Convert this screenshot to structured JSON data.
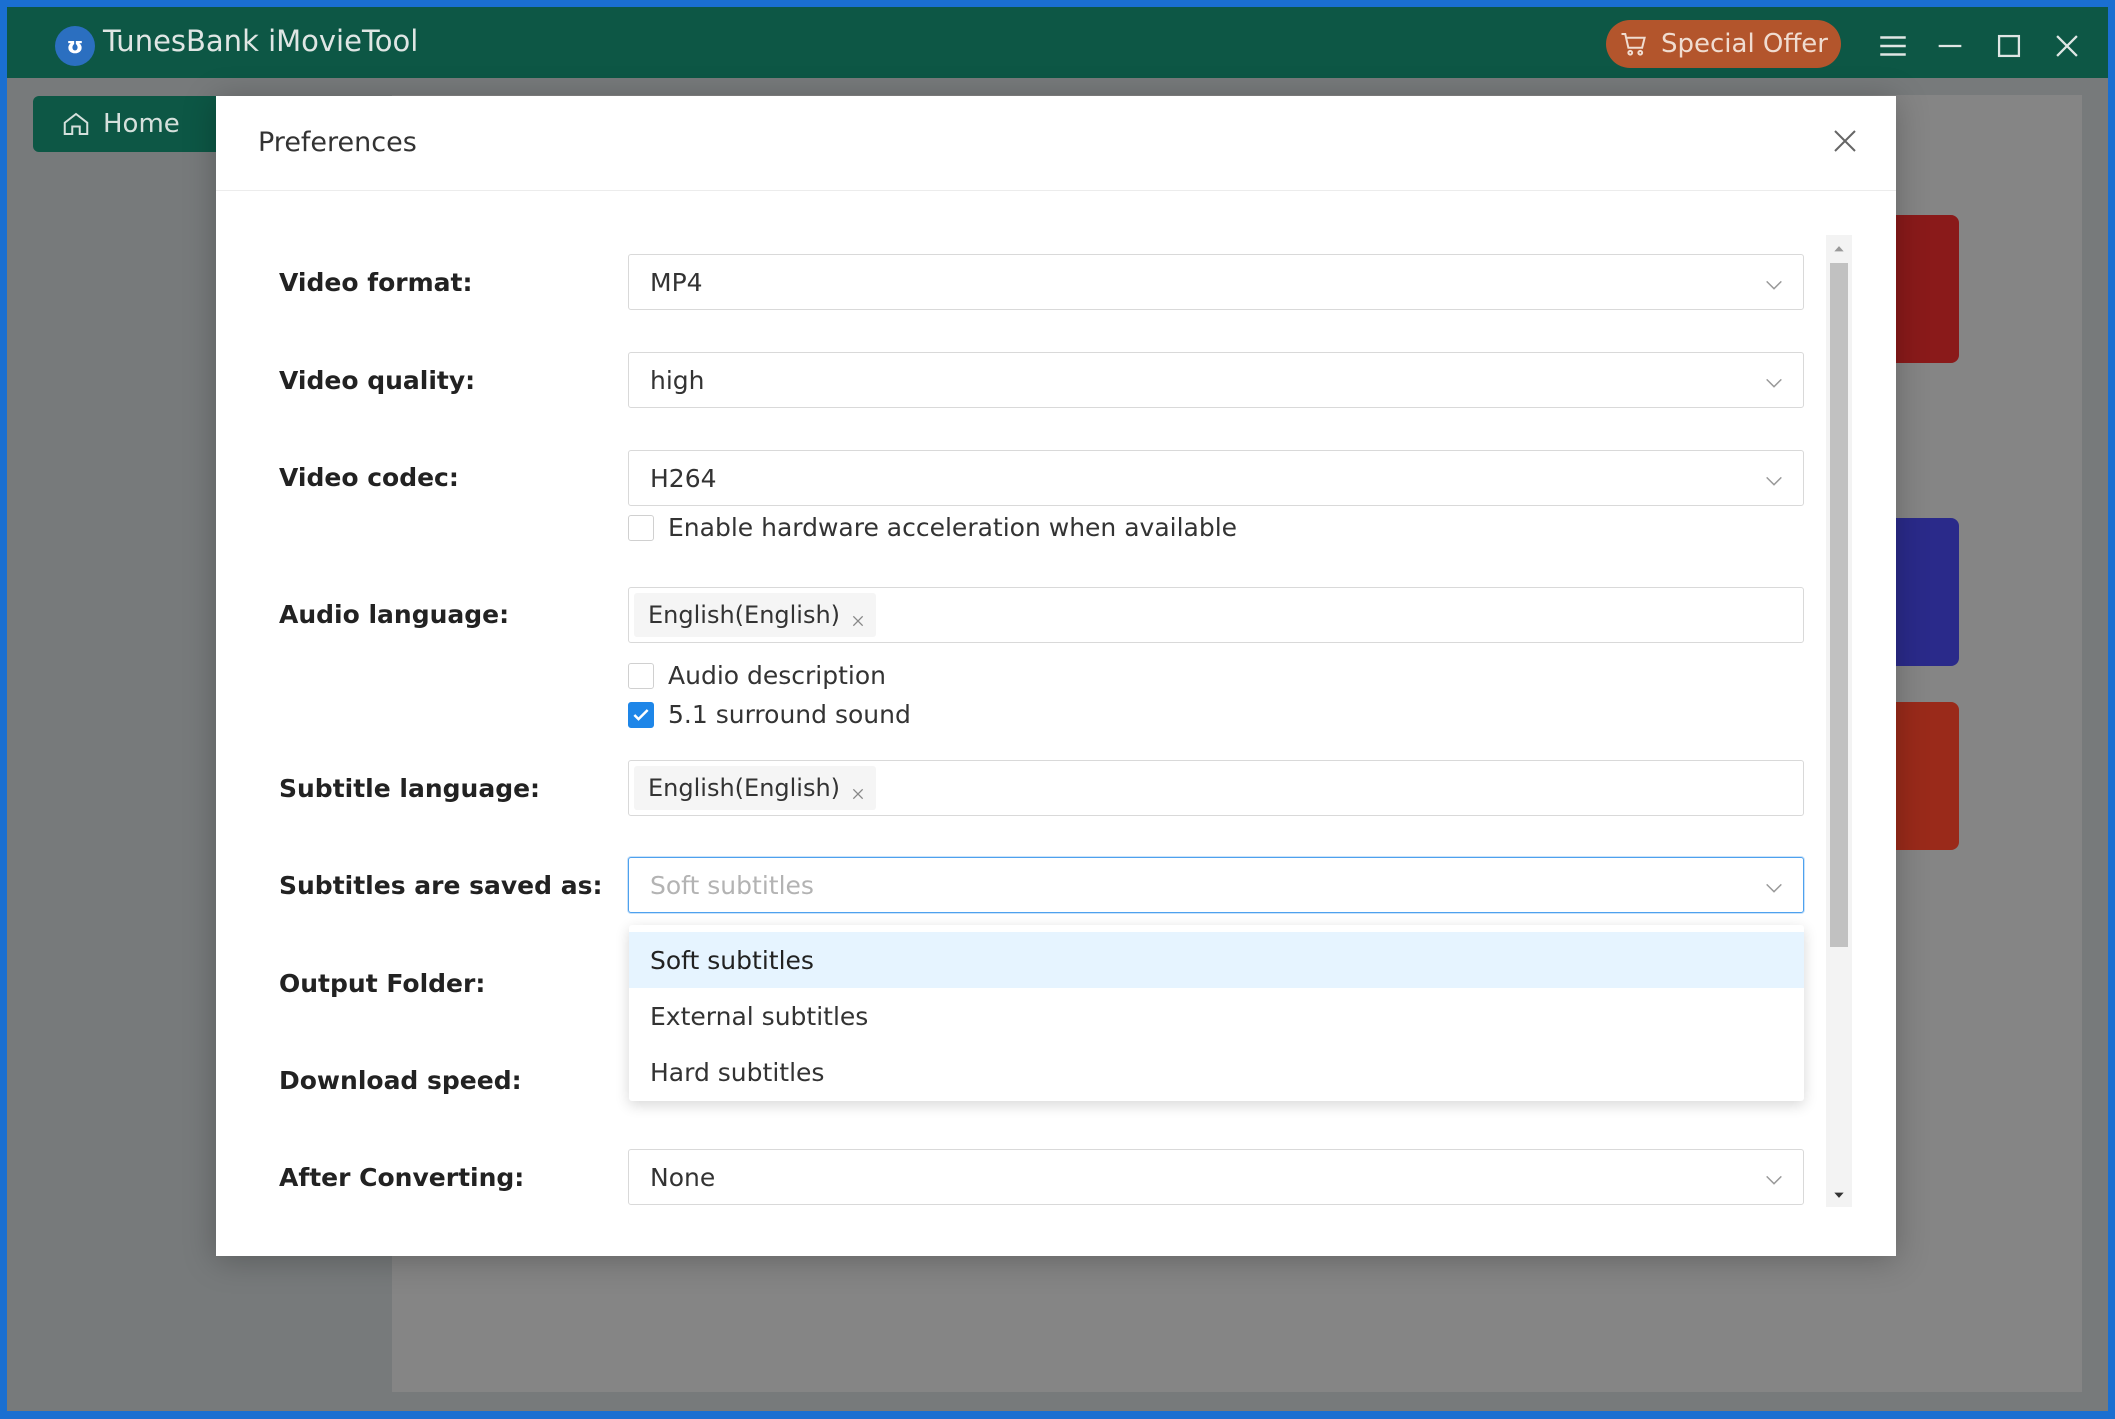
{
  "app": {
    "title": "TunesBank iMovieTool",
    "logo_glyph": "ʊ",
    "special_offer_label": "Special Offer",
    "home_label": "Home",
    "colors": {
      "titlebar": "#0d5745",
      "accent_blue": "#1e86e8",
      "offer": "#b3552c"
    }
  },
  "window_controls": [
    "menu-icon",
    "minimize-icon",
    "maximize-icon",
    "close-icon"
  ],
  "dialog": {
    "title": "Preferences",
    "video_format": {
      "label": "Video format:",
      "value": "MP4"
    },
    "video_quality": {
      "label": "Video quality:",
      "value": "high"
    },
    "video_codec": {
      "label": "Video codec:",
      "value": "H264",
      "hw_accel_label": "Enable hardware acceleration when available",
      "hw_accel_checked": false
    },
    "audio_language": {
      "label": "Audio language:",
      "tags": [
        "English(English)"
      ],
      "audio_description_label": "Audio description",
      "audio_description_checked": false,
      "surround_label": "5.1 surround sound",
      "surround_checked": true
    },
    "subtitle_language": {
      "label": "Subtitle language:",
      "tags": [
        "English(English)"
      ]
    },
    "subtitles_saved_as": {
      "label": "Subtitles are saved as:",
      "placeholder": "Soft subtitles",
      "options": [
        "Soft subtitles",
        "External subtitles",
        "Hard subtitles"
      ],
      "highlighted_option": "Soft subtitles"
    },
    "output_folder": {
      "label": "Output Folder:"
    },
    "download_speed": {
      "label": "Download speed:"
    },
    "after_converting": {
      "label": "After Converting:",
      "value": "None"
    }
  }
}
